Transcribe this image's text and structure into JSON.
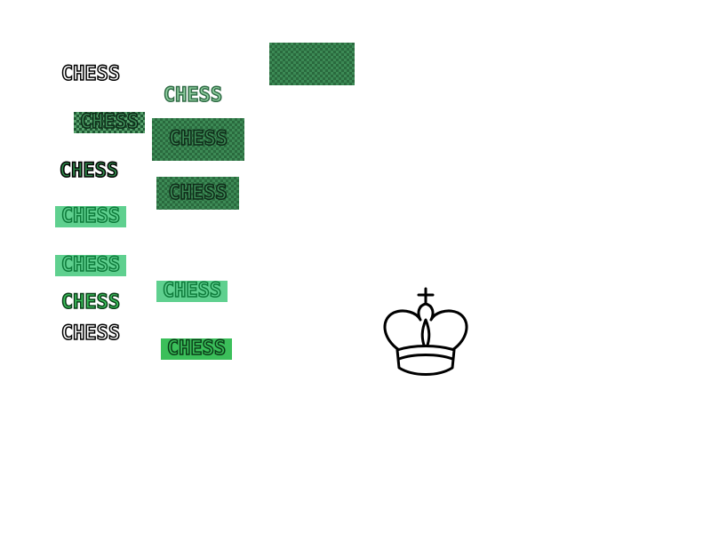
{
  "logo_text": "CHESS",
  "colors": {
    "dark_green": "#2a6a3e",
    "mid_green": "#3c8a55",
    "light_green": "#5fd08f",
    "bright_green": "#3bbf5a",
    "outline": "#000000"
  },
  "sprites": [
    {
      "id": "s1",
      "text": "CHESS"
    },
    {
      "id": "s2",
      "text": "CHESS"
    },
    {
      "id": "s3",
      "text": "CHESS"
    },
    {
      "id": "s4",
      "text": "CHESS"
    },
    {
      "id": "s5",
      "text": "CHESS"
    },
    {
      "id": "s6",
      "text": "CHESS"
    },
    {
      "id": "s7",
      "text": "CHESS"
    },
    {
      "id": "s8",
      "text": "CHESS"
    },
    {
      "id": "s9",
      "text": "CHESS"
    },
    {
      "id": "s10",
      "text": "CHESS"
    },
    {
      "id": "s11",
      "text": "CHESS"
    },
    {
      "id": "s12",
      "text": "CHESS"
    }
  ],
  "icons": {
    "checker_tile": "checkerboard-tile-icon",
    "king": "chess-king-icon"
  }
}
